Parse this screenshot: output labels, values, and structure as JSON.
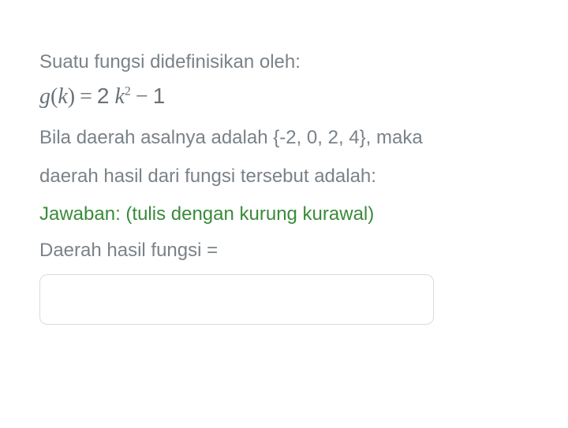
{
  "intro_text": "Suatu fungsi didefinisikan oleh:",
  "formula": {
    "function_name": "g",
    "variable": "k",
    "coefficient": "2",
    "exponent": "2",
    "constant": "1"
  },
  "question_line1": "Bila daerah asalnya adalah {-2, 0, 2, 4}, maka",
  "question_line2": "daerah hasil dari fungsi tersebut adalah:",
  "answer_hint": "Jawaban: (tulis dengan kurung kurawal)",
  "answer_label": "Daerah hasil fungsi =",
  "answer_value": ""
}
